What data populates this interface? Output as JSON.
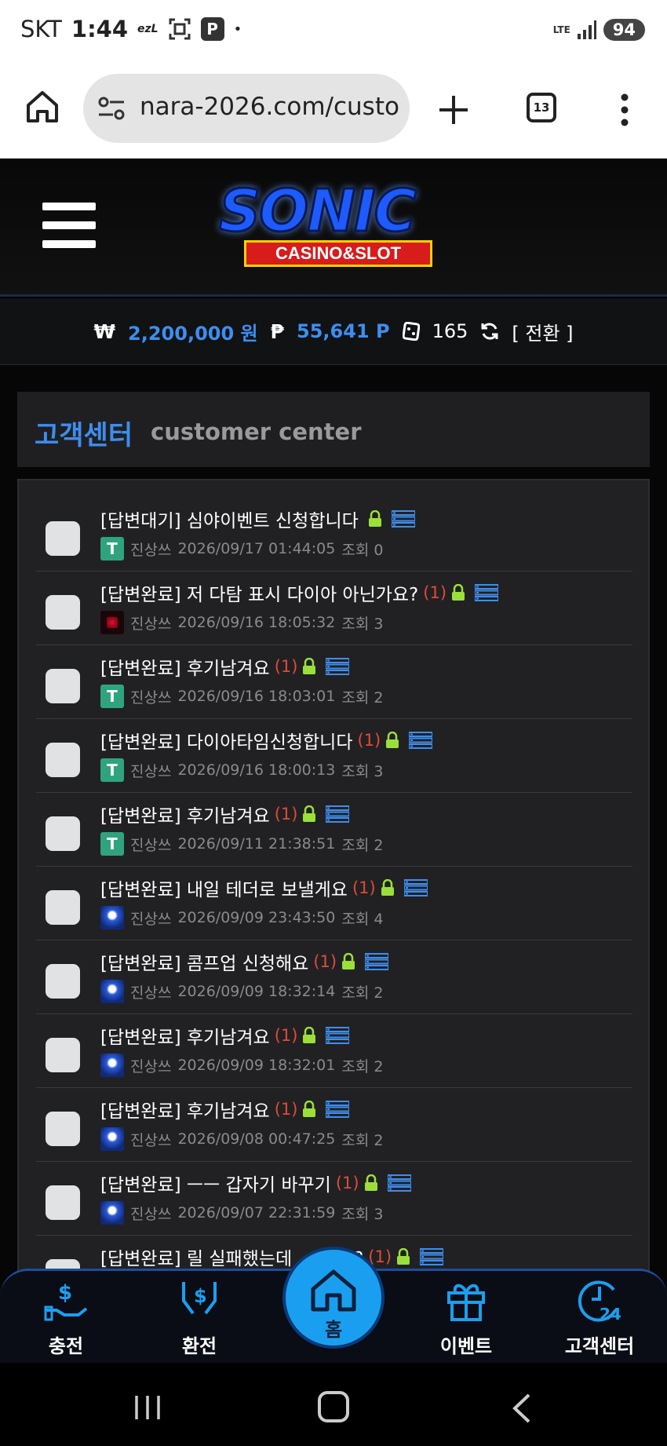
{
  "status_bar": {
    "carrier": "SKT",
    "time": "1:44",
    "notif_text": "ezL",
    "notif_p": "P",
    "dot": "•",
    "network": "LTE",
    "battery": "94"
  },
  "browser": {
    "url": "nara-2026.com/custo",
    "tab_count": "13"
  },
  "logo": {
    "main": "SONIC",
    "sub": "CASINO&SLOT"
  },
  "balance": {
    "won_symbol": "₩",
    "won_value": "2,200,000 원",
    "point_symbol": "₱",
    "point_value": "55,641 P",
    "coupon_count": "165",
    "switch_label": "[ 전환 ]"
  },
  "customer_center": {
    "title_ko": "고객센터",
    "title_en": "customer center"
  },
  "posts": [
    {
      "title": "[답변대기] 심야이벤트 신청합니다",
      "count": "",
      "author": "진상쓰",
      "date": "2026/09/17 01:44:05",
      "views": "조회 0",
      "avatar": "tether"
    },
    {
      "title": "[답변완료] 저 다탐 표시 다이아 아닌가요?",
      "count": "(1)",
      "author": "진상쓰",
      "date": "2026/09/16 18:05:32",
      "views": "조회 3",
      "avatar": "red"
    },
    {
      "title": "[답변완료] 후기남겨요",
      "count": "(1)",
      "author": "진상쓰",
      "date": "2026/09/16 18:03:01",
      "views": "조회 2",
      "avatar": "tether"
    },
    {
      "title": "[답변완료] 다이아타임신청합니다",
      "count": "(1)",
      "author": "진상쓰",
      "date": "2026/09/16 18:00:13",
      "views": "조회 3",
      "avatar": "tether"
    },
    {
      "title": "[답변완료] 후기남겨요",
      "count": "(1)",
      "author": "진상쓰",
      "date": "2026/09/11 21:38:51",
      "views": "조회 2",
      "avatar": "tether"
    },
    {
      "title": "[답변완료] 내일 테더로 보낼게요",
      "count": "(1)",
      "author": "진상쓰",
      "date": "2026/09/09 23:43:50",
      "views": "조회 4",
      "avatar": "sonic"
    },
    {
      "title": "[답변완료] 콤프업 신청해요",
      "count": "(1)",
      "author": "진상쓰",
      "date": "2026/09/09 18:32:14",
      "views": "조회 2",
      "avatar": "sonic"
    },
    {
      "title": "[답변완료] 후기남겨요",
      "count": "(1)",
      "author": "진상쓰",
      "date": "2026/09/09 18:32:01",
      "views": "조회 2",
      "avatar": "sonic"
    },
    {
      "title": "[답변완료] 후기남겨요",
      "count": "(1)",
      "author": "진상쓰",
      "date": "2026/09/08 00:47:25",
      "views": "조회 2",
      "avatar": "sonic"
    },
    {
      "title": "[답변완료] ㅡㅡ 갑자기 바꾸기",
      "count": "(1)",
      "author": "진상쓰",
      "date": "2026/09/07 22:31:59",
      "views": "조회 3",
      "avatar": "sonic"
    },
    {
      "title": "[답변완료] 릴 실패했는데 ... 나요?",
      "count": "(1)",
      "author": "",
      "date": "",
      "views": "",
      "avatar": "sonic"
    }
  ],
  "bottom_nav": {
    "deposit": "충전",
    "withdraw": "환전",
    "home": "홈",
    "event": "이벤트",
    "support": "고객센터"
  },
  "colors": {
    "accent_blue": "#3d8ef0",
    "count_red": "#e04a3a",
    "home_button": "#1a9ff0"
  }
}
